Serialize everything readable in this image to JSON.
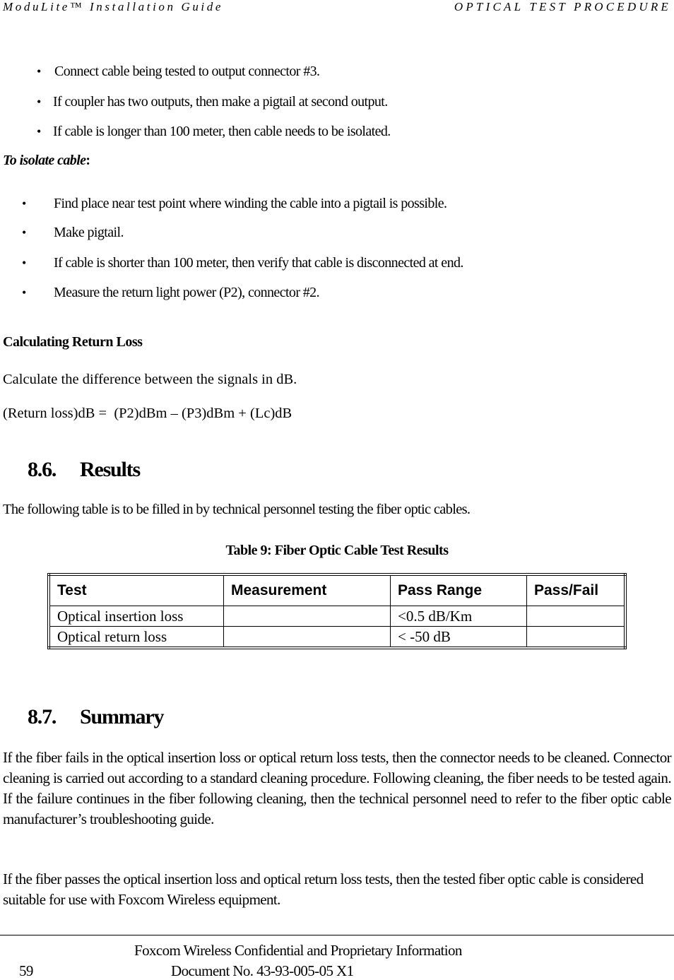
{
  "header": {
    "left": "ModuLite™ Installation Guide",
    "right": "OPTICAL TEST PROCEDURE"
  },
  "connect_steps": [
    "Connect cable being tested to output connector #3.",
    "If coupler has two outputs, then make a pigtail at second output.",
    "If cable is longer than 100 meter, then cable needs to be isolated."
  ],
  "isolate": {
    "heading": "To isolate cable",
    "colon": ":",
    "steps": [
      "Find place near test point where winding the cable into a pigtail is possible.",
      "Make pigtail.",
      "If cable is shorter than 100 meter, then verify that cable is disconnected at end.",
      "Measure the return light power (P2), connector #2."
    ]
  },
  "bullet_glyph": "•",
  "calculating": {
    "heading": "Calculating Return Loss",
    "text": "Calculate the difference between the signals in dB.",
    "formula": "(Return loss)dB =  (P2)dBm – (P3)dBm + (Lc)dB"
  },
  "results": {
    "number": "8.6.",
    "title": "Results",
    "intro": "The following table is to be filled in by technical personnel testing the fiber optic cables.",
    "caption": "Table 9:  Fiber Optic Cable Test Results",
    "table": {
      "headers": [
        "Test",
        "Measurement",
        "Pass Range",
        "Pass/Fail"
      ],
      "rows": [
        [
          "Optical insertion loss",
          "",
          "<0.5 dB/Km",
          ""
        ],
        [
          "Optical return loss",
          "",
          "< -50 dB",
          ""
        ]
      ]
    }
  },
  "summary": {
    "number": "8.7.",
    "title": "Summary",
    "paragraphs": [
      "If the fiber fails in the optical insertion loss or optical return loss tests, then the connector needs to be cleaned. Connector cleaning is carried out according to a standard cleaning procedure. Following cleaning, the fiber needs to be tested again. If the failure continues in the fiber following cleaning, then the technical personnel need to refer to the fiber optic cable manufacturer’s troubleshooting guide.",
      "If the fiber passes the optical insertion loss and optical return loss tests, then the tested fiber optic cable is considered suitable for use with Foxcom Wireless equipment."
    ]
  },
  "footer": {
    "confidential": "Foxcom Wireless Confidential and Proprietary Information",
    "page_number": "59",
    "document_no": "Document No. 43-93-005-05 X1"
  }
}
